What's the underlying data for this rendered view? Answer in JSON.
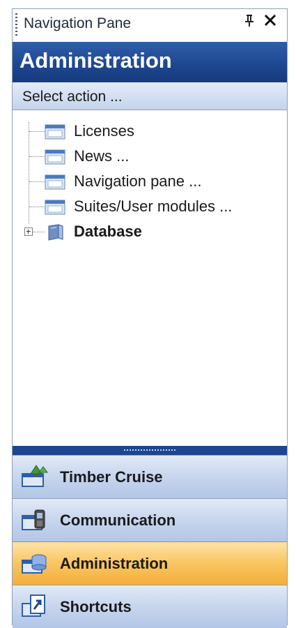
{
  "titlebar": {
    "title": "Navigation Pane",
    "pin_glyph": "t",
    "close_glyph": "✕"
  },
  "header": {
    "title": "Administration"
  },
  "subheader": {
    "text": "Select action ..."
  },
  "tree": {
    "items": [
      {
        "label": "Licenses",
        "icon": "window-icon"
      },
      {
        "label": "News ...",
        "icon": "window-icon"
      },
      {
        "label": "Navigation pane ...",
        "icon": "window-icon"
      },
      {
        "label": "Suites/User modules ...",
        "icon": "window-icon"
      },
      {
        "label": "Database",
        "icon": "book-icon",
        "expandable": true
      }
    ]
  },
  "nav_buttons": [
    {
      "label": "Timber Cruise",
      "icon": "timber-cruise-icon",
      "active": false
    },
    {
      "label": "Communication",
      "icon": "communication-icon",
      "active": false
    },
    {
      "label": "Administration",
      "icon": "administration-icon",
      "active": true
    },
    {
      "label": "Shortcuts",
      "icon": "shortcuts-icon",
      "active": false
    }
  ],
  "colors": {
    "header": "#1d4690",
    "active_button": "#f9c867",
    "button": "#c9d7ee"
  }
}
